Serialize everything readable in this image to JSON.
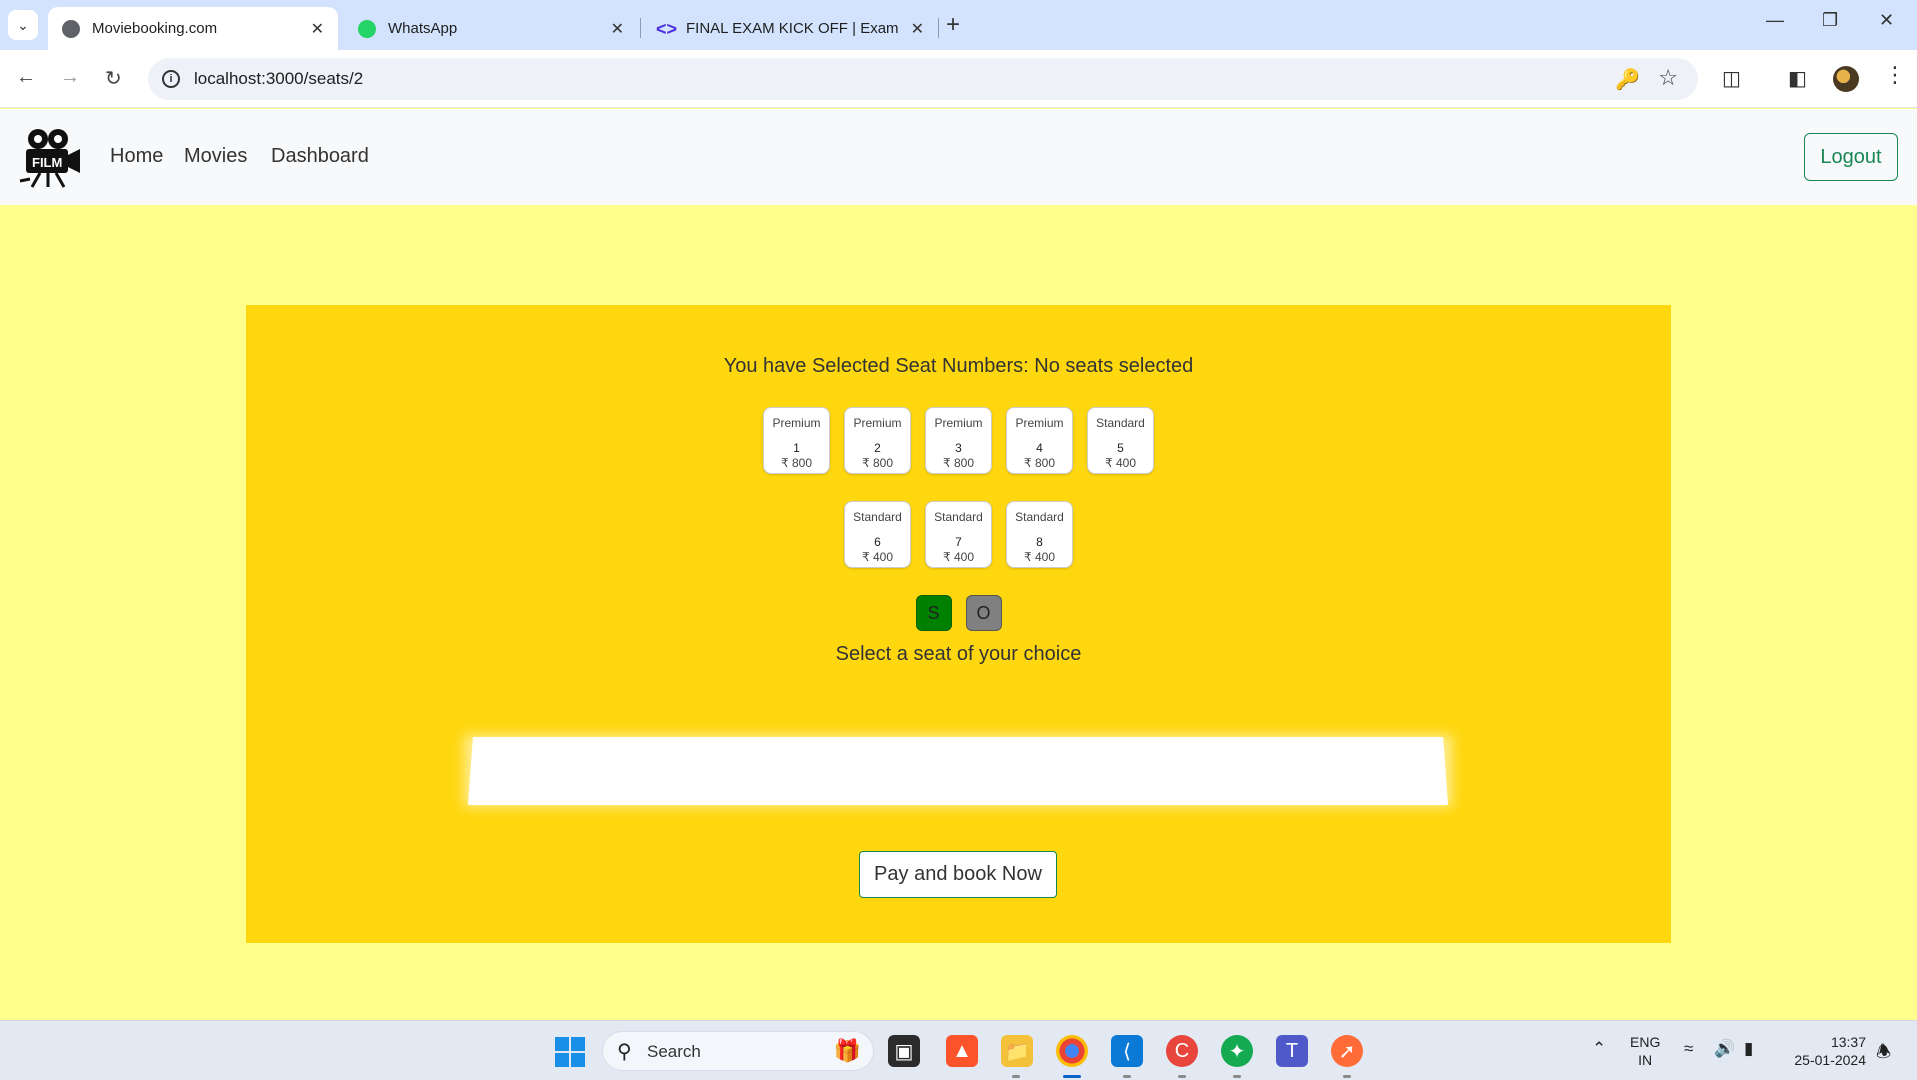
{
  "browser": {
    "tabs": [
      {
        "label": "Moviebooking.com",
        "active": true
      },
      {
        "label": "WhatsApp",
        "active": false
      },
      {
        "label": "FINAL EXAM KICK OFF | Exam |",
        "active": false
      }
    ],
    "url": "localhost:3000/seats/2"
  },
  "site": {
    "logo_text": "FILM",
    "nav": {
      "home": "Home",
      "movies": "Movies",
      "dashboard": "Dashboard"
    },
    "logout": "Logout"
  },
  "booking": {
    "selected_label": "You have Selected Seat Numbers: No seats selected",
    "seats": [
      {
        "type": "Premium",
        "number": "1",
        "price": "₹ 800"
      },
      {
        "type": "Premium",
        "number": "2",
        "price": "₹ 800"
      },
      {
        "type": "Premium",
        "number": "3",
        "price": "₹ 800"
      },
      {
        "type": "Premium",
        "number": "4",
        "price": "₹ 800"
      },
      {
        "type": "Standard",
        "number": "5",
        "price": "₹ 400"
      },
      {
        "type": "Standard",
        "number": "6",
        "price": "₹ 400"
      },
      {
        "type": "Standard",
        "number": "7",
        "price": "₹ 400"
      },
      {
        "type": "Standard",
        "number": "8",
        "price": "₹ 400"
      }
    ],
    "legend": [
      {
        "label": "S",
        "color": "#008000"
      },
      {
        "label": "O",
        "color": "#808080"
      }
    ],
    "hint": "Select a seat of your choice",
    "pay_button": "Pay and book Now"
  },
  "taskbar": {
    "search": "Search",
    "lang_top": "ENG",
    "lang_bottom": "IN",
    "time": "13:37",
    "date": "25-01-2024"
  },
  "colors": {
    "page_bg": "#ffff8d",
    "panel_bg": "#ffd70f",
    "accent_green": "#198754"
  }
}
